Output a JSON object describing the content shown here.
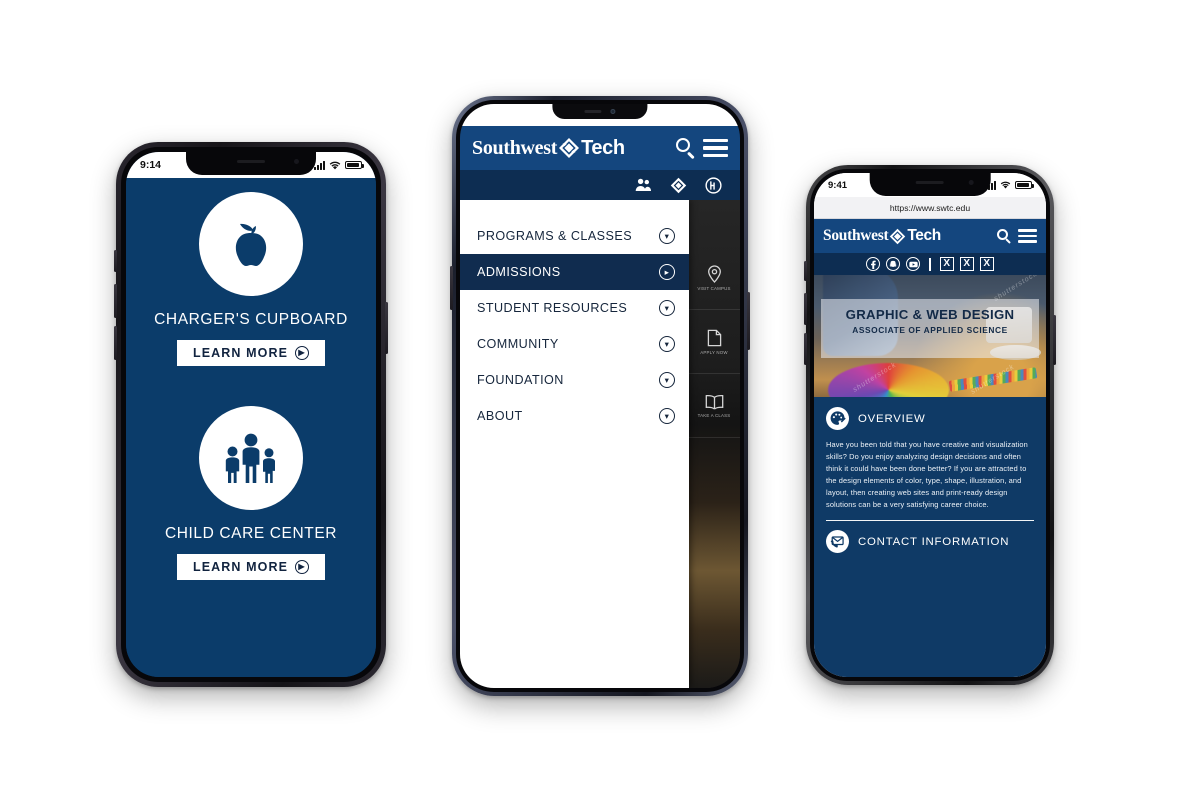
{
  "phone_left": {
    "device_name": "iphone-dark",
    "status_bar": {
      "time": "9:14",
      "signal_icon": "cellular-bars-icon",
      "wifi_icon": "wifi-icon",
      "battery_icon": "battery-icon"
    },
    "background_color": "#0b3c6a",
    "cards": [
      {
        "icon": "apple-icon",
        "title": "CHARGER'S CUPBOARD",
        "button_label": "LEARN MORE",
        "button_icon": "arrow-right-circle-icon"
      },
      {
        "icon": "family-icon",
        "title": "CHILD CARE CENTER",
        "button_label": "LEARN MORE",
        "button_icon": "arrow-right-circle-icon"
      }
    ]
  },
  "phone_center": {
    "device_name": "android-teardrop-notch",
    "header": {
      "logo_word_1": "Southwest",
      "logo_mark": "diamond-logo-icon",
      "logo_word_2": "Tech",
      "search_icon": "search-icon",
      "menu_icon": "hamburger-menu-icon",
      "background_color": "#14467e"
    },
    "utility_bar": {
      "background_color": "#0d2d52",
      "icons": [
        "people-group-icon",
        "diamond-logo-icon",
        "circled-h-icon"
      ]
    },
    "menu": {
      "items": [
        {
          "label": "PROGRAMS & CLASSES",
          "icon": "chevron-down-circle-icon",
          "active": false
        },
        {
          "label": "ADMISSIONS",
          "icon": "chevron-right-circle-icon",
          "active": true
        },
        {
          "label": "STUDENT RESOURCES",
          "icon": "chevron-down-circle-icon",
          "active": false
        },
        {
          "label": "COMMUNITY",
          "icon": "chevron-down-circle-icon",
          "active": false
        },
        {
          "label": "FOUNDATION",
          "icon": "chevron-down-circle-icon",
          "active": false
        },
        {
          "label": "ABOUT",
          "icon": "chevron-down-circle-icon",
          "active": false
        }
      ],
      "active_item_color": "#102c4f"
    },
    "background_tiles": [
      {
        "label": "VISIT CAMPUS",
        "icon": "map-pin-icon"
      },
      {
        "label": "APPLY NOW",
        "icon": "document-icon"
      },
      {
        "label": "TAKE A CLASS",
        "icon": "open-book-icon"
      }
    ]
  },
  "phone_right": {
    "device_name": "iphone-dark",
    "status_bar": {
      "time": "9:41",
      "signal_icon": "cellular-bars-icon",
      "wifi_icon": "wifi-icon",
      "battery_icon": "battery-icon"
    },
    "url_bar": {
      "url": "https://www.swtc.edu"
    },
    "header": {
      "logo_word_1": "Southwest",
      "logo_mark": "diamond-logo-icon",
      "logo_word_2": "Tech",
      "search_icon": "search-icon",
      "menu_icon": "hamburger-menu-icon",
      "background_color": "#14467e"
    },
    "social_bar": {
      "background_color": "#0d2d52",
      "icons": [
        "facebook-icon",
        "snapchat-icon",
        "youtube-icon"
      ],
      "placeholders": [
        "X",
        "X",
        "X"
      ]
    },
    "hero": {
      "title": "GRAPHIC & WEB DESIGN",
      "subtitle": "ASSOCIATE OF APPLIED SCIENCE",
      "watermarks": [
        "shutterstock",
        "shutterstock",
        "shutterstock"
      ]
    },
    "overview": {
      "icon": "paint-palette-icon",
      "heading": "OVERVIEW",
      "body": "Have you been told that you have creative and visualization skills? Do you enjoy analyzing design decisions and often think it could have been done better? If you are attracted to the design elements of color, type, shape, illustration, and layout, then creating web sites and print-ready design solutions can be a very satisfying career choice."
    },
    "contact": {
      "icon": "envelope-phone-icon",
      "heading": "CONTACT INFORMATION"
    },
    "background_color": "#0f3a66"
  }
}
